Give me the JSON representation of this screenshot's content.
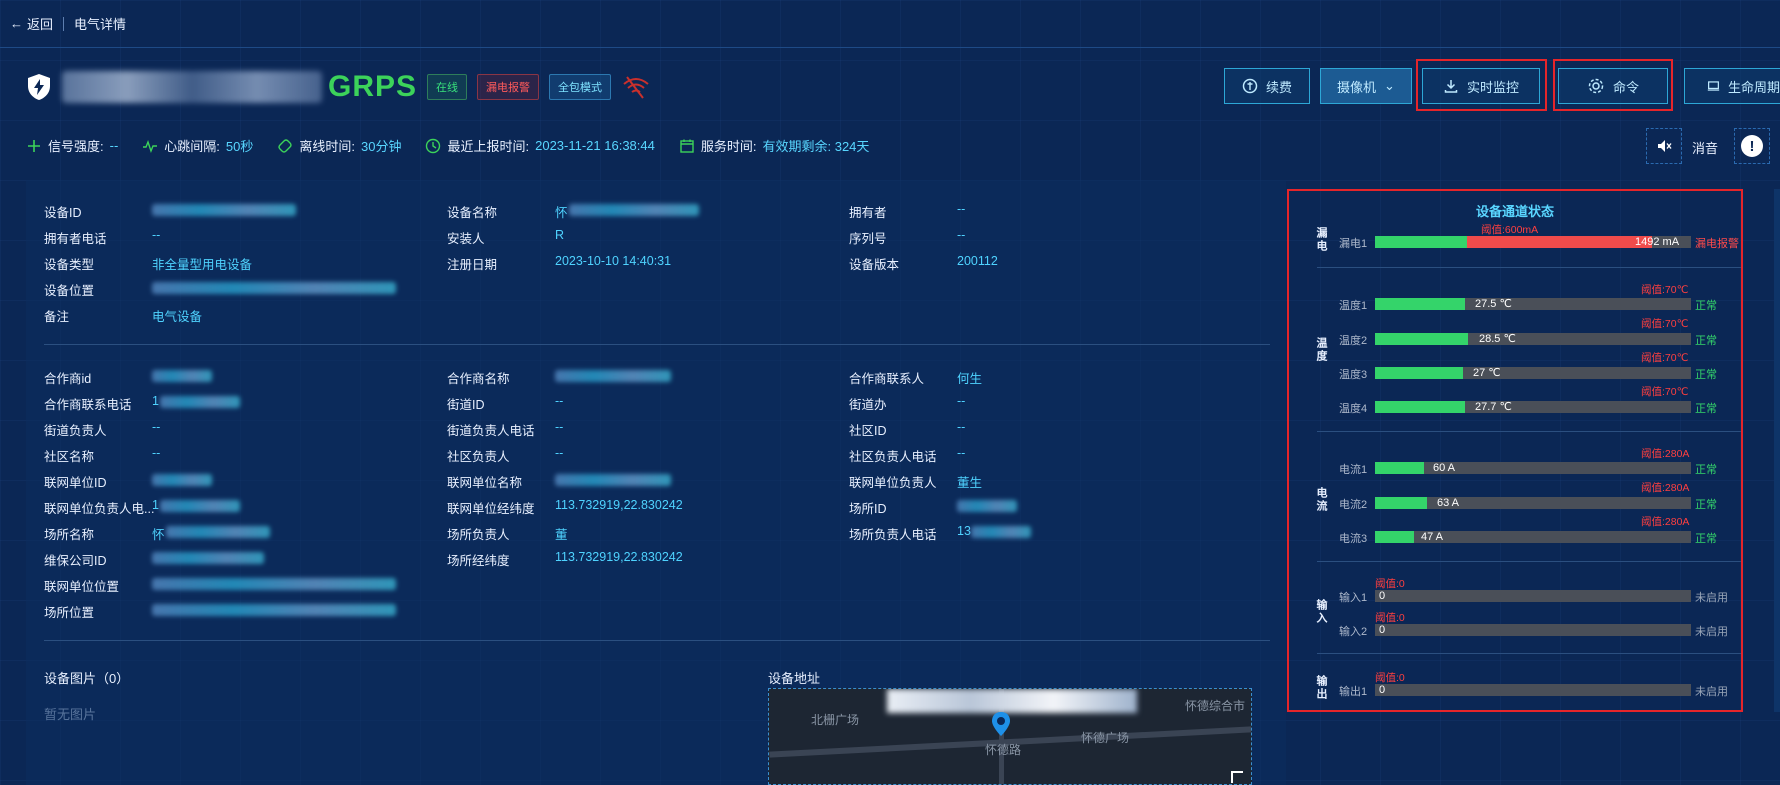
{
  "topbar": {
    "back_label": "返回",
    "crumb": "电气详情"
  },
  "header": {
    "title_suffix": "GRPS",
    "tags": {
      "online": "在线",
      "alarm": "漏电报警",
      "mode": "全包模式"
    }
  },
  "actions": {
    "renew": "续费",
    "camera": "摄像机",
    "monitor": "实时监控",
    "command": "命令",
    "lifecycle": "生命周期"
  },
  "stats": {
    "signal_label": "信号强度:",
    "signal_value": "--",
    "heartbeat_label": "心跳间隔:",
    "heartbeat_value": "50秒",
    "offline_label": "离线时间:",
    "offline_value": "30分钟",
    "last_report_label": "最近上报时间:",
    "last_report_value": "2023-11-21 16:38:44",
    "service_label": "服务时间:",
    "service_value": "有效期剩余: 324天",
    "mute_label": "消音"
  },
  "info": {
    "device_id_l": "设备ID",
    "owner_phone_l": "拥有者电话",
    "owner_phone_v": "--",
    "device_type_l": "设备类型",
    "device_type_v": "非全量型用电设备",
    "device_loc_l": "设备位置",
    "remark_l": "备注",
    "remark_v": "电气设备",
    "device_name_l": "设备名称",
    "device_name_v": "怀",
    "installer_l": "安装人",
    "installer_v": "R",
    "reg_date_l": "注册日期",
    "reg_date_v": "2023-10-10 14:40:31",
    "owner_l": "拥有者",
    "owner_v": "--",
    "serial_l": "序列号",
    "serial_v": "--",
    "version_l": "设备版本",
    "version_v": "200112"
  },
  "partner": {
    "partner_id_l": "合作商id",
    "partner_phone_l": "合作商联系电话",
    "partner_phone_v": "1",
    "street_head_l": "街道负责人",
    "street_head_v": "--",
    "community_name_l": "社区名称",
    "community_name_v": "--",
    "net_unit_id_l": "联网单位ID",
    "net_unit_head_phone_l": "联网单位负责人电...",
    "net_unit_head_phone_v": "1",
    "site_name_l": "场所名称",
    "site_name_v": "怀",
    "maint_id_l": "维保公司ID",
    "net_unit_loc_l": "联网单位位置",
    "site_loc_l": "场所位置",
    "partner_name_l": "合作商名称",
    "street_id_l": "街道ID",
    "street_id_v": "--",
    "street_head_phone_l": "街道负责人电话",
    "street_head_phone_v": "--",
    "community_head_l": "社区负责人",
    "community_head_v": "--",
    "net_unit_name_l": "联网单位名称",
    "net_unit_coord_l": "联网单位经纬度",
    "net_unit_coord_v": "113.732919,22.830242",
    "site_head_l": "场所负责人",
    "site_head_v": "董",
    "site_coord_l": "场所经纬度",
    "site_coord_v": "113.732919,22.830242",
    "partner_contact_l": "合作商联系人",
    "partner_contact_v": "何生",
    "street_office_l": "街道办",
    "street_office_v": "--",
    "community_id_l": "社区ID",
    "community_id_v": "--",
    "community_head_phone_l": "社区负责人电话",
    "community_head_phone_v": "--",
    "net_unit_head_l": "联网单位负责人",
    "net_unit_head_v": "董生",
    "site_id_l": "场所ID",
    "site_head_phone_l": "场所负责人电话",
    "site_head_phone_v": "13"
  },
  "pictures": {
    "title": "设备图片（0）",
    "empty": "暂无图片"
  },
  "address": {
    "title": "设备地址",
    "map_labels": [
      "北栅广场",
      "怀德路",
      "怀德广场",
      "怀德综合市"
    ]
  },
  "channels": {
    "title": "设备通道状态",
    "groups": {
      "leak": "漏电",
      "temp": "温度",
      "current": "电流",
      "input": "输入",
      "output": "输出"
    },
    "leak": [
      {
        "name": "漏电1",
        "threshold": "阈值:600mA",
        "value": "1492 mA",
        "status": "漏电报警",
        "fraction": 0.875,
        "threshold_fraction": 0.29
      }
    ],
    "temp": [
      {
        "name": "温度1",
        "threshold": "阈值:70℃",
        "value": "27.5 ℃",
        "status": "正常",
        "fraction": 0.285
      },
      {
        "name": "温度2",
        "threshold": "阈值:70℃",
        "value": "28.5 ℃",
        "status": "正常",
        "fraction": 0.295
      },
      {
        "name": "温度3",
        "threshold": "阈值:70℃",
        "value": "27 ℃",
        "status": "正常",
        "fraction": 0.28
      },
      {
        "name": "温度4",
        "threshold": "阈值:70℃",
        "value": "27.7 ℃",
        "status": "正常",
        "fraction": 0.285
      }
    ],
    "current": [
      {
        "name": "电流1",
        "threshold": "阈值:280A",
        "value": "60 A",
        "status": "正常",
        "fraction": 0.155
      },
      {
        "name": "电流2",
        "threshold": "阈值:280A",
        "value": "63 A",
        "status": "正常",
        "fraction": 0.163
      },
      {
        "name": "电流3",
        "threshold": "阈值:280A",
        "value": "47 A",
        "status": "正常",
        "fraction": 0.122
      }
    ],
    "input": [
      {
        "name": "输入1",
        "threshold": "阈值:0",
        "value": "0",
        "status": "未启用"
      },
      {
        "name": "输入2",
        "threshold": "阈值:0",
        "value": "0",
        "status": "未启用"
      }
    ],
    "output": [
      {
        "name": "输出1",
        "threshold": "阈值:0",
        "value": "0",
        "status": "未启用"
      }
    ]
  }
}
